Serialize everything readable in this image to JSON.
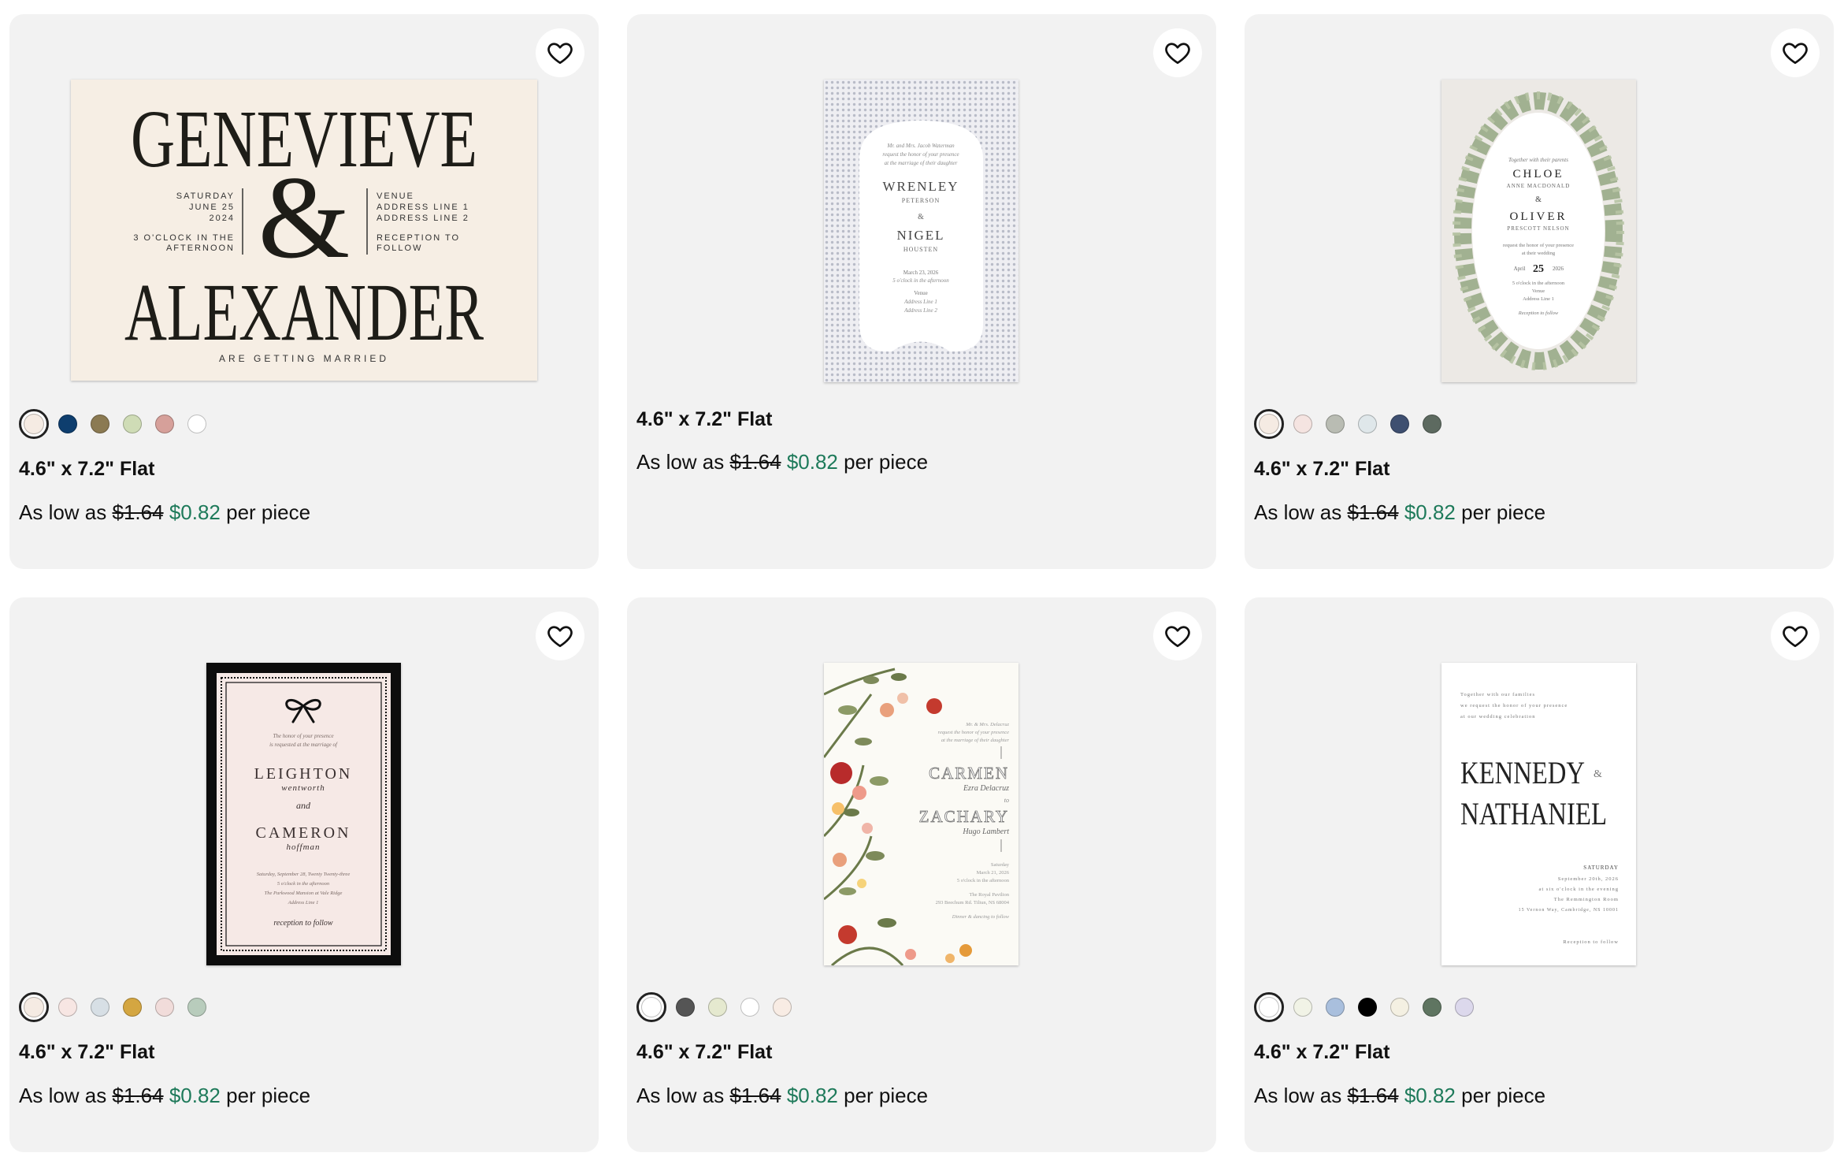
{
  "products": [
    {
      "size": "4.6\" x 7.2\" Flat",
      "price_prefix": "As low as",
      "original_price": "$1.64",
      "sale_price": "$0.82",
      "price_suffix": "per piece",
      "swatches": [
        "#f5ebe3",
        "#0e3e6e",
        "#8b7a52",
        "#cfdcb6",
        "#d6a09a",
        "#ffffff"
      ],
      "card_text": {
        "name1": "GENEVIEVE",
        "amp": "&",
        "name2": "ALEXANDER",
        "left1": "SATURDAY",
        "left2": "JUNE 25",
        "left3": "2024",
        "left4": "3 O'CLOCK IN THE",
        "left5": "AFTERNOON",
        "right1": "VENUE",
        "right2": "ADDRESS LINE 1",
        "right3": "ADDRESS LINE 2",
        "right4": "RECEPTION TO",
        "right5": "FOLLOW",
        "footer": "ARE GETTING MARRIED"
      }
    },
    {
      "size": "4.6\" x 7.2\" Flat",
      "price_prefix": "As low as",
      "original_price": "$1.64",
      "sale_price": "$0.82",
      "price_suffix": "per piece",
      "swatches": [],
      "card_text": {
        "line1": "Mr. and Mrs. Jacob Waterman",
        "line2": "request the honor of your presence",
        "line3": "at the marriage of their daughter",
        "name1": "WRENLEY",
        "sub1": "PETERSON",
        "amp": "&",
        "name2": "NIGEL",
        "sub2": "HOUSTEN",
        "date": "March 23, 2026",
        "time": "5 o'clock in the afternoon",
        "venue": "Venue",
        "addr1": "Address Line 1",
        "addr2": "Address Line 2"
      }
    },
    {
      "size": "4.6\" x 7.2\" Flat",
      "price_prefix": "As low as",
      "original_price": "$1.64",
      "sale_price": "$0.82",
      "price_suffix": "per piece",
      "swatches": [
        "#f5ebe3",
        "#f5e4e1",
        "#b9bcb3",
        "#dfe7ea",
        "#3e4f70",
        "#5d6a60"
      ],
      "card_text": {
        "line1": "Together with their parents",
        "name1": "CHLOE",
        "sub1": "ANNE MACDONALD",
        "amp": "&",
        "name2": "OLIVER",
        "sub2": "PRESCOTT NELSON",
        "req1": "request the honor of your presence",
        "req2": "at their wedding",
        "month": "April",
        "day": "25",
        "year": "2026",
        "time": "5 o'clock in the afternoon",
        "venue": "Venue",
        "addr": "Address Line 1",
        "reception": "Reception to follow"
      }
    },
    {
      "size": "4.6\" x 7.2\" Flat",
      "price_prefix": "As low as",
      "original_price": "$1.64",
      "sale_price": "$0.82",
      "price_suffix": "per piece",
      "swatches": [
        "#f5ebe3",
        "#f7e6e3",
        "#d7dfe5",
        "#d4a641",
        "#f1dcda",
        "#b8ccbc"
      ],
      "card_text": {
        "line1": "The honor of your presence",
        "line2": "is requested at the marriage of",
        "name1": "LEIGHTON",
        "sub1": "wentworth",
        "and": "and",
        "name2": "CAMERON",
        "sub2": "hoffman",
        "date": "Saturday, September 28, Twenty Twenty-three",
        "time": "5 o'clock in the afternoon",
        "venue": "The Parkwood Mansion at Vale Ridge",
        "addr": "Address Line 1",
        "reception": "reception to follow"
      }
    },
    {
      "size": "4.6\" x 7.2\" Flat",
      "price_prefix": "As low as",
      "original_price": "$1.64",
      "sale_price": "$0.82",
      "price_suffix": "per piece",
      "swatches": [
        "#ffffff",
        "#555555",
        "#e5e9cf",
        "#ffffff",
        "#f8ece4"
      ],
      "card_text": {
        "line1": "Mr. & Mrs. Delacruz",
        "line2": "request the honor of your presence",
        "line3": "at the marriage of their daughter",
        "name1": "CARMEN",
        "sub1": "Ezra Delacruz",
        "and": "to",
        "name2": "ZACHARY",
        "sub2": "Hugo Lambert",
        "day": "Saturday",
        "date": "March 21, 2026",
        "time": "5 o'clock in the afternoon",
        "venue": "The Royal Pavilion",
        "addr": "293 Beechum Rd. Tiliun, NS 68004",
        "dinner": "Dinner & dancing to follow"
      }
    },
    {
      "size": "4.6\" x 7.2\" Flat",
      "price_prefix": "As low as",
      "original_price": "$1.64",
      "sale_price": "$0.82",
      "price_suffix": "per piece",
      "swatches": [
        "#ffffff",
        "#f1f3e6",
        "#a9bfdd",
        "#000000",
        "#f4f0e2",
        "#5f7561",
        "#dcd8ec"
      ],
      "card_text": {
        "line1": "Together with our families",
        "line2": "we request the honor of your presence",
        "line3": "at our wedding celebration",
        "name1": "KENNEDY",
        "amp": "&",
        "name2": "NATHANIEL",
        "day": "SATURDAY",
        "date": "September 20th, 2026",
        "time": "at six o'clock in the evening",
        "venue": "The Remmington Room",
        "addr": "15 Vernon Way, Cambridge, NS 10001",
        "reception": "Reception to follow"
      }
    }
  ]
}
